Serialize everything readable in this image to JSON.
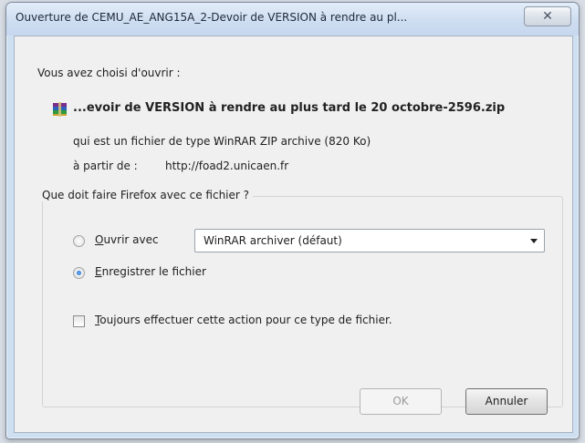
{
  "window": {
    "title": "Ouverture de CEMU_AE_ANG15A_2-Devoir de VERSION à rendre au pl...",
    "close_label": "✕"
  },
  "dialog": {
    "intro": "Vous avez choisi d'ouvrir :",
    "file_icon": "winrar-archive-icon",
    "filename": "...evoir de VERSION à rendre au plus tard le 20 octobre-2596.zip",
    "type_label": "qui est un fichier de type :",
    "type_value": "WinRAR ZIP archive (820 Ko)",
    "from_label": "à partir de :",
    "from_value": "http://foad2.unicaen.fr",
    "group_title": "Que doit faire Firefox avec ce fichier ?",
    "open_with_label": "Ouvrir avec",
    "open_with_mnemonic": "O",
    "open_with_rest": "uvrir avec",
    "open_with_value": "WinRAR archiver (défaut)",
    "save_mnemonic": "E",
    "save_rest": "nregistrer le fichier",
    "always_mnemonic": "T",
    "always_rest": "oujours effectuer cette action pour ce type de fichier.",
    "selected_option": "save",
    "always_checked": false
  },
  "buttons": {
    "ok": "OK",
    "cancel": "Annuler"
  }
}
